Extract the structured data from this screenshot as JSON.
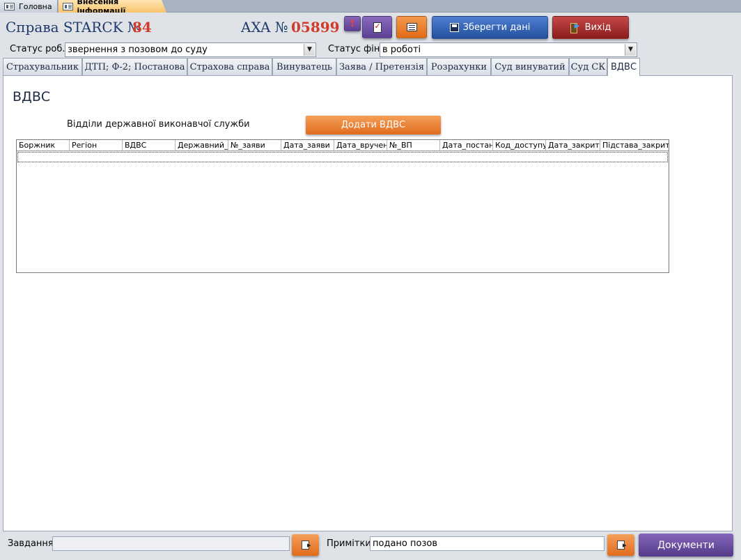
{
  "doc_tabs": [
    {
      "label": "Головна",
      "icon": "form-icon"
    },
    {
      "label": "Внесення інформації",
      "icon": "form-icon"
    }
  ],
  "header": {
    "case_label": "Справа STARCK №",
    "case_number": "84",
    "axa_label": "AXA №",
    "axa_number": "05899",
    "alert_glyph": "!",
    "save_label": "Зберегти дані",
    "exit_label": "Вихід",
    "status_work_label": "Статус роб.",
    "status_work_value": "звернення з позовом до суду",
    "status_fin_label": "Статус фін.",
    "status_fin_value": "в роботі",
    "accent_orange": "#e06b1d",
    "accent_purple": "#5d3f93",
    "accent_blue": "#23519e",
    "accent_red": "#8c1d1d",
    "number_color": "#d23a2a"
  },
  "form_tabs": [
    {
      "label": "Страхувальник"
    },
    {
      "label": "ДТП; Ф-2; Постанова"
    },
    {
      "label": "Страхова справа"
    },
    {
      "label": "Винуватець"
    },
    {
      "label": "Заява / Претензія"
    },
    {
      "label": "Розрахунки"
    },
    {
      "label": "Суд винуватий"
    },
    {
      "label": "Суд СК"
    },
    {
      "label": "ВДВС",
      "active": true
    }
  ],
  "main": {
    "title": "ВДВС",
    "subtitle": "Відділи державної виконавчої служби",
    "add_button": "Додати ВДВС",
    "grid_columns": [
      "Боржник",
      "Регіон",
      "ВДВС",
      "Державний_",
      "№_заяви",
      "Дата_заяви",
      "Дата_вручен",
      "№_ВП",
      "Дата_постан",
      "Код_доступу",
      "Дата_закрит",
      "Підстава_закрит"
    ]
  },
  "footer": {
    "tasks_label": "Завдання",
    "tasks_value": "",
    "notes_label": "Примітки",
    "notes_value": "подано позов",
    "documents_button": "Документи"
  }
}
